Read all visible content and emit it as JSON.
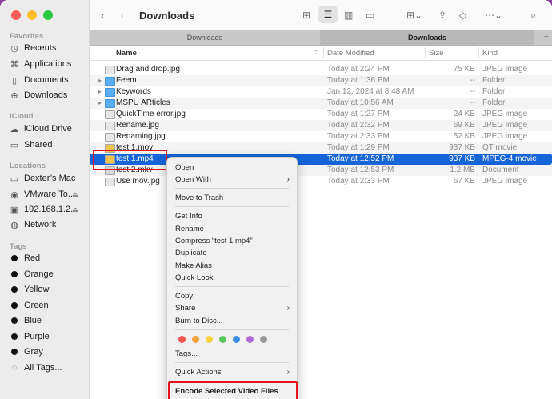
{
  "colors": {
    "accent": "#1565d8",
    "highlight_box": "#e0161b",
    "red": "#fe5f57",
    "yellow": "#febc2e",
    "green": "#28c840"
  },
  "window": {
    "title": "Downloads"
  },
  "sidebar": {
    "favorites_header": "Favorites",
    "favorites": [
      {
        "label": "Recents",
        "icon": "clock-icon"
      },
      {
        "label": "Applications",
        "icon": "applications-icon"
      },
      {
        "label": "Documents",
        "icon": "document-icon"
      },
      {
        "label": "Downloads",
        "icon": "download-icon"
      }
    ],
    "icloud_header": "iCloud",
    "icloud": [
      {
        "label": "iCloud Drive",
        "icon": "cloud-icon"
      },
      {
        "label": "Shared",
        "icon": "shared-folder-icon"
      }
    ],
    "locations_header": "Locations",
    "locations": [
      {
        "label": "Dexter’s Mac",
        "icon": "laptop-icon"
      },
      {
        "label": "VMware To...",
        "icon": "disk-icon"
      },
      {
        "label": "192.168.1.2...",
        "icon": "display-icon"
      },
      {
        "label": "Network",
        "icon": "globe-icon"
      }
    ],
    "tags_header": "Tags",
    "tags": [
      {
        "label": "Red",
        "color": "#111111"
      },
      {
        "label": "Orange",
        "color": "#111111"
      },
      {
        "label": "Yellow",
        "color": "#111111"
      },
      {
        "label": "Green",
        "color": "#111111"
      },
      {
        "label": "Blue",
        "color": "#111111"
      },
      {
        "label": "Purple",
        "color": "#111111"
      },
      {
        "label": "Gray",
        "color": "#111111"
      },
      {
        "label": "All Tags...",
        "icon": "all-tags-icon"
      }
    ]
  },
  "tabs": [
    {
      "label": "Downloads",
      "active": false
    },
    {
      "label": "Downloads",
      "active": true
    }
  ],
  "columns": {
    "name": "Name",
    "date": "Date Modified",
    "size": "Size",
    "kind": "Kind"
  },
  "files": [
    {
      "name": "Drag and drop.jpg",
      "date": "Today at 2:24 PM",
      "size": "75 KB",
      "kind": "JPEG image",
      "type": "image"
    },
    {
      "name": "Feem",
      "date": "Today at 1:36 PM",
      "size": "--",
      "kind": "Folder",
      "type": "folder"
    },
    {
      "name": "Keywords",
      "date": "Jan 12, 2024 at 8:48 AM",
      "size": "--",
      "kind": "Folder",
      "type": "folder"
    },
    {
      "name": "MSPU ARticles",
      "date": "Today at 10:56 AM",
      "size": "--",
      "kind": "Folder",
      "type": "folder"
    },
    {
      "name": "QuickTime error.jpg",
      "date": "Today at 1:27 PM",
      "size": "24 KB",
      "kind": "JPEG image",
      "type": "image"
    },
    {
      "name": "Rename.jpg",
      "date": "Today at 2:32 PM",
      "size": "69 KB",
      "kind": "JPEG image",
      "type": "image"
    },
    {
      "name": "Renaming.jpg",
      "date": "Today at 2:33 PM",
      "size": "52 KB",
      "kind": "JPEG image",
      "type": "image"
    },
    {
      "name": "test 1.mov",
      "date": "Today at 1:29 PM",
      "size": "937 KB",
      "kind": "QT movie",
      "type": "movie"
    },
    {
      "name": "test 1.mp4",
      "date": "Today at 12:52 PM",
      "size": "937 KB",
      "kind": "MPEG-4 movie",
      "type": "movie",
      "selected": true
    },
    {
      "name": "test 2.mkv",
      "date": "Today at 12:53 PM",
      "size": "1.2 MB",
      "kind": "Document",
      "type": "doc"
    },
    {
      "name": "Use mov.jpg",
      "date": "Today at 2:33 PM",
      "size": "67 KB",
      "kind": "JPEG image",
      "type": "image"
    }
  ],
  "context_menu": {
    "open": "Open",
    "open_with": "Open With",
    "move_to_trash": "Move to Trash",
    "get_info": "Get Info",
    "rename": "Rename",
    "compress": "Compress “test 1.mp4”",
    "duplicate": "Duplicate",
    "make_alias": "Make Alias",
    "quick_look": "Quick Look",
    "copy": "Copy",
    "share": "Share",
    "burn": "Burn to Disc...",
    "tag_colors": [
      "#f0524f",
      "#f6a23a",
      "#f5d23a",
      "#5ac55a",
      "#3a8ef0",
      "#b06ad8",
      "#9a9a9a"
    ],
    "tags": "Tags...",
    "quick_actions": "Quick Actions",
    "encode": "Encode Selected Video Files"
  }
}
